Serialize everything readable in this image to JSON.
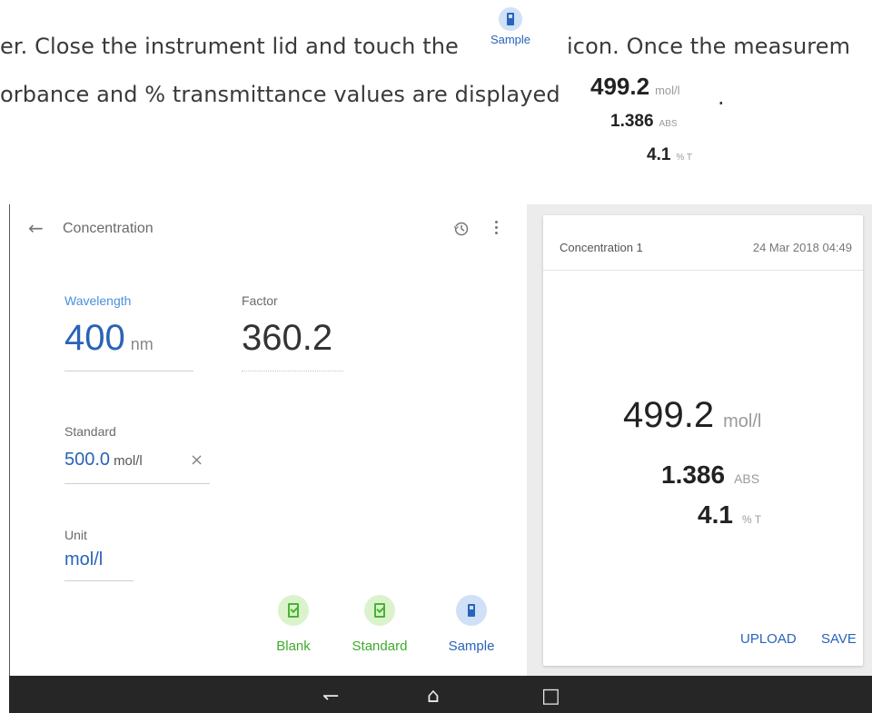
{
  "instruction": {
    "line1_before": "er. Close the instrument lid and touch the",
    "line1_after": "icon. Once the measurem",
    "line2": "orbance and % transmittance values are displayed",
    "period": ".",
    "inline_icon_label": "Sample",
    "inline_results": [
      {
        "value": "499.2",
        "unit": "mol/l"
      },
      {
        "value": "1.386",
        "unit": "ABS"
      },
      {
        "value": "4.1",
        "unit": "% T"
      }
    ]
  },
  "appbar": {
    "title": "Concentration",
    "back_icon": "back-arrow-icon",
    "history_icon": "history-icon",
    "menu_icon": "more-vert-icon"
  },
  "fields": {
    "wavelength": {
      "label": "Wavelength",
      "value": "400",
      "unit": "nm"
    },
    "factor": {
      "label": "Factor",
      "value": "360.2"
    },
    "standard": {
      "label": "Standard",
      "value": "500.0",
      "unit": "mol/l",
      "clear_icon": "×"
    },
    "unit": {
      "label": "Unit",
      "value": "mol/l"
    }
  },
  "actions": [
    {
      "label": "Blank",
      "icon": "blank-check-icon",
      "color": "#3faa2c"
    },
    {
      "label": "Standard",
      "icon": "standard-check-icon",
      "color": "#3faa2c"
    },
    {
      "label": "Sample",
      "icon": "sample-vial-icon",
      "color": "#2a63b8"
    }
  ],
  "result_card": {
    "name": "Concentration 1",
    "date": "24 Mar 2018 04:49",
    "results": [
      {
        "value": "499.2",
        "unit": "mol/l"
      },
      {
        "value": "1.386",
        "unit": "ABS"
      },
      {
        "value": "4.1",
        "unit": "% T"
      }
    ],
    "upload_label": "UPLOAD",
    "save_label": "SAVE"
  },
  "system_nav": {
    "back": "↽",
    "home": "⌂",
    "recents": "□"
  },
  "colors": {
    "accent": "#2a63b8",
    "success": "#3faa2c",
    "sysbar": "#262626"
  }
}
